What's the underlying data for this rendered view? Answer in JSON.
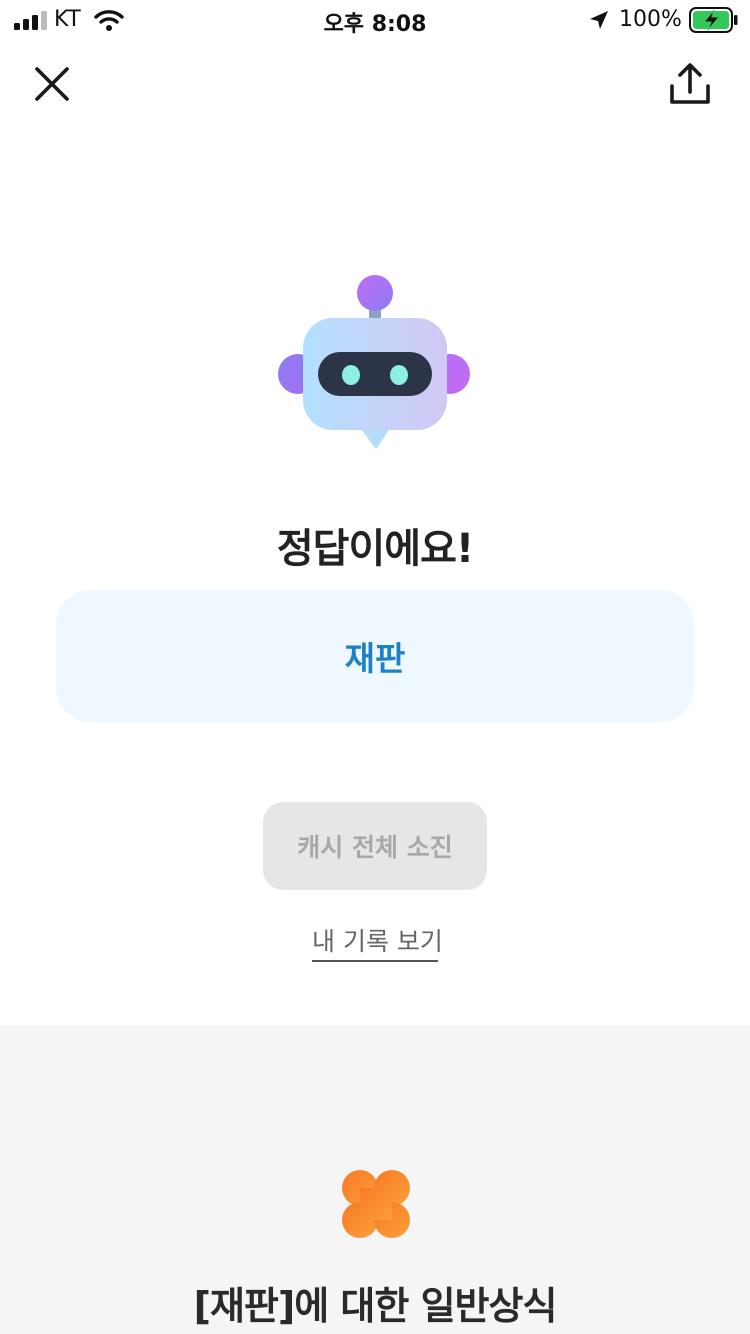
{
  "status_bar": {
    "carrier": "KT",
    "time": "오후 8:08",
    "battery": "100%"
  },
  "nav": {
    "close_icon": "close-icon",
    "share_icon": "share-upload-icon"
  },
  "result": {
    "title": "정답이에요!",
    "answer": "재판",
    "cash_button_label": "캐시 전체 소진",
    "history_link": "내 기록 보기"
  },
  "info": {
    "icon": "clover-icon",
    "title": "[재판]에 대한 일반상식"
  },
  "colors": {
    "answer_text": "#1b82c7",
    "answer_card_bg": "#eff7ff",
    "disabled_button_bg": "#e6e6e6",
    "clover": "#f68a2a",
    "battery_green": "#34c759"
  }
}
